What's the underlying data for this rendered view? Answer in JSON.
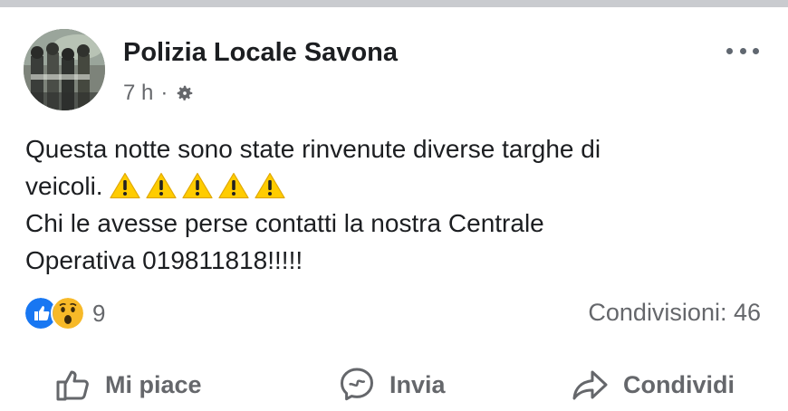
{
  "post": {
    "author": "Polizia Locale Savona",
    "timestamp": "7 h",
    "separator": "·",
    "audience_icon": "gear-icon",
    "menu_icon": "more-options-icon",
    "body_lines": [
      "Questa notte sono state rinvenute diverse targhe di",
      "veicoli.",
      "Chi le avesse perse contatti la nostra Centrale",
      "Operativa 019811818!!!!!"
    ],
    "warning_emoji_count": 5,
    "warning_emoji_icon": "warning-sign-icon"
  },
  "stats": {
    "reaction_icons": [
      "like-reaction-icon",
      "wow-reaction-icon"
    ],
    "reaction_count": "9",
    "shares_label": "Condivisioni: 46"
  },
  "actions": {
    "like": {
      "label": "Mi piace",
      "icon": "thumbs-up-icon"
    },
    "send": {
      "label": "Invia",
      "icon": "messenger-icon"
    },
    "share": {
      "label": "Condividi",
      "icon": "share-arrow-icon"
    }
  },
  "colors": {
    "text_primary": "#1c1e21",
    "text_secondary": "#65676b",
    "like_blue": "#1877f2",
    "wow_yellow": "#f7b928",
    "warning_yellow": "#ffcc00",
    "top_bar": "#c9cbcf"
  }
}
